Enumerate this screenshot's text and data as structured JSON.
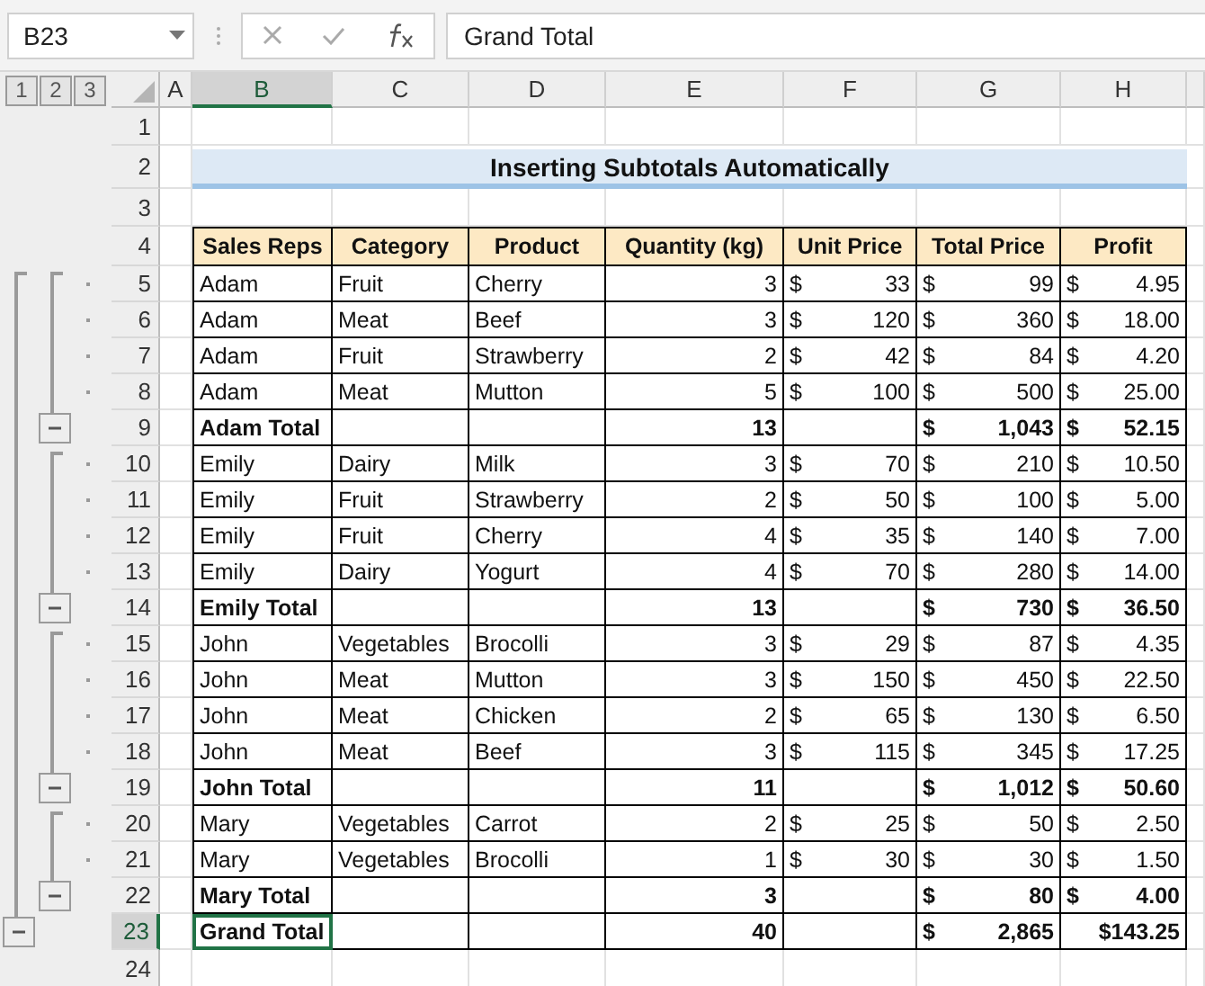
{
  "formula_bar": {
    "name_box": "B23",
    "formula": "Grand Total"
  },
  "outline_levels": [
    "1",
    "2",
    "3"
  ],
  "columns": [
    {
      "label": "A",
      "selected": false
    },
    {
      "label": "B",
      "selected": true
    },
    {
      "label": "C",
      "selected": false
    },
    {
      "label": "D",
      "selected": false
    },
    {
      "label": "E",
      "selected": false
    },
    {
      "label": "F",
      "selected": false
    },
    {
      "label": "G",
      "selected": false
    },
    {
      "label": "H",
      "selected": false
    }
  ],
  "rows": [
    {
      "number": "1",
      "kind": "blank",
      "selected": false
    },
    {
      "number": "2",
      "kind": "title",
      "selected": false,
      "title": "Inserting Subtotals Automatically"
    },
    {
      "number": "3",
      "kind": "blank",
      "selected": false
    },
    {
      "number": "4",
      "kind": "header",
      "selected": false,
      "cells": [
        "Sales Reps",
        "Category",
        "Product",
        "Quantity (kg)",
        "Unit Price",
        "Total Price",
        "Profit"
      ]
    },
    {
      "number": "5",
      "kind": "detail",
      "selected": false,
      "cells": [
        "Adam",
        "Fruit",
        "Cherry",
        "3",
        [
          "$",
          "33"
        ],
        [
          "$",
          "99"
        ],
        [
          "$",
          "4.95"
        ]
      ]
    },
    {
      "number": "6",
      "kind": "detail",
      "selected": false,
      "cells": [
        "Adam",
        "Meat",
        "Beef",
        "3",
        [
          "$",
          "120"
        ],
        [
          "$",
          "360"
        ],
        [
          "$",
          "18.00"
        ]
      ]
    },
    {
      "number": "7",
      "kind": "detail",
      "selected": false,
      "cells": [
        "Adam",
        "Fruit",
        "Strawberry",
        "2",
        [
          "$",
          "42"
        ],
        [
          "$",
          "84"
        ],
        [
          "$",
          "4.20"
        ]
      ]
    },
    {
      "number": "8",
      "kind": "detail",
      "selected": false,
      "cells": [
        "Adam",
        "Meat",
        "Mutton",
        "5",
        [
          "$",
          "100"
        ],
        [
          "$",
          "500"
        ],
        [
          "$",
          "25.00"
        ]
      ]
    },
    {
      "number": "9",
      "kind": "subtotal",
      "selected": false,
      "cells": [
        "Adam Total",
        null,
        null,
        "13",
        null,
        [
          "$",
          "1,043"
        ],
        [
          "$",
          "52.15"
        ]
      ]
    },
    {
      "number": "10",
      "kind": "detail",
      "selected": false,
      "cells": [
        "Emily",
        "Dairy",
        "Milk",
        "3",
        [
          "$",
          "70"
        ],
        [
          "$",
          "210"
        ],
        [
          "$",
          "10.50"
        ]
      ]
    },
    {
      "number": "11",
      "kind": "detail",
      "selected": false,
      "cells": [
        "Emily",
        "Fruit",
        "Strawberry",
        "2",
        [
          "$",
          "50"
        ],
        [
          "$",
          "100"
        ],
        [
          "$",
          "5.00"
        ]
      ]
    },
    {
      "number": "12",
      "kind": "detail",
      "selected": false,
      "cells": [
        "Emily",
        "Fruit",
        "Cherry",
        "4",
        [
          "$",
          "35"
        ],
        [
          "$",
          "140"
        ],
        [
          "$",
          "7.00"
        ]
      ]
    },
    {
      "number": "13",
      "kind": "detail",
      "selected": false,
      "cells": [
        "Emily",
        "Dairy",
        "Yogurt",
        "4",
        [
          "$",
          "70"
        ],
        [
          "$",
          "280"
        ],
        [
          "$",
          "14.00"
        ]
      ]
    },
    {
      "number": "14",
      "kind": "subtotal",
      "selected": false,
      "cells": [
        "Emily Total",
        null,
        null,
        "13",
        null,
        [
          "$",
          "730"
        ],
        [
          "$",
          "36.50"
        ]
      ]
    },
    {
      "number": "15",
      "kind": "detail",
      "selected": false,
      "cells": [
        "John",
        "Vegetables",
        "Brocolli",
        "3",
        [
          "$",
          "29"
        ],
        [
          "$",
          "87"
        ],
        [
          "$",
          "4.35"
        ]
      ]
    },
    {
      "number": "16",
      "kind": "detail",
      "selected": false,
      "cells": [
        "John",
        "Meat",
        "Mutton",
        "3",
        [
          "$",
          "150"
        ],
        [
          "$",
          "450"
        ],
        [
          "$",
          "22.50"
        ]
      ]
    },
    {
      "number": "17",
      "kind": "detail",
      "selected": false,
      "cells": [
        "John",
        "Meat",
        "Chicken",
        "2",
        [
          "$",
          "65"
        ],
        [
          "$",
          "130"
        ],
        [
          "$",
          "6.50"
        ]
      ]
    },
    {
      "number": "18",
      "kind": "detail",
      "selected": false,
      "cells": [
        "John",
        "Meat",
        "Beef",
        "3",
        [
          "$",
          "115"
        ],
        [
          "$",
          "345"
        ],
        [
          "$",
          "17.25"
        ]
      ]
    },
    {
      "number": "19",
      "kind": "subtotal",
      "selected": false,
      "cells": [
        "John Total",
        null,
        null,
        "11",
        null,
        [
          "$",
          "1,012"
        ],
        [
          "$",
          "50.60"
        ]
      ]
    },
    {
      "number": "20",
      "kind": "detail",
      "selected": false,
      "cells": [
        "Mary",
        "Vegetables",
        "Carrot",
        "2",
        [
          "$",
          "25"
        ],
        [
          "$",
          "50"
        ],
        [
          "$",
          "2.50"
        ]
      ]
    },
    {
      "number": "21",
      "kind": "detail",
      "selected": false,
      "cells": [
        "Mary",
        "Vegetables",
        "Brocolli",
        "1",
        [
          "$",
          "30"
        ],
        [
          "$",
          "30"
        ],
        [
          "$",
          "1.50"
        ]
      ]
    },
    {
      "number": "22",
      "kind": "subtotal",
      "selected": false,
      "cells": [
        "Mary Total",
        null,
        null,
        "3",
        null,
        [
          "$",
          "80"
        ],
        [
          "$",
          "4.00"
        ]
      ]
    },
    {
      "number": "23",
      "kind": "grandtotal",
      "selected": true,
      "cells": [
        "Grand Total",
        null,
        null,
        "40",
        null,
        [
          "$",
          "2,865"
        ],
        [
          "$143.25"
        ]
      ]
    },
    {
      "number": "24",
      "kind": "blank",
      "selected": false
    }
  ]
}
